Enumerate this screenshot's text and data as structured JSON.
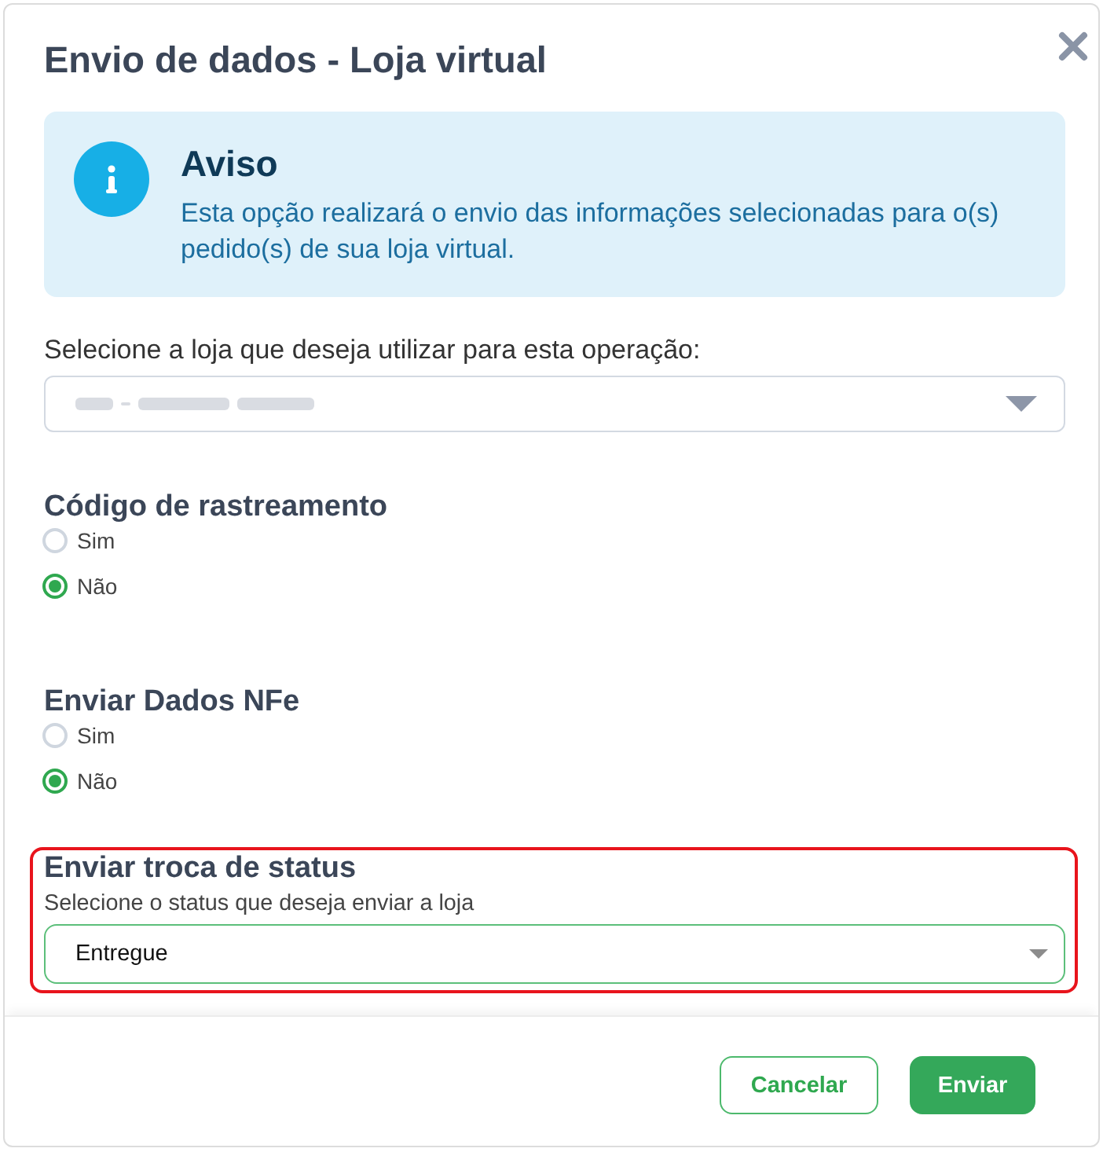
{
  "dialog": {
    "title": "Envio de dados - Loja virtual"
  },
  "notice": {
    "title": "Aviso",
    "text": "Esta opção realizará o envio das informações selecionadas para o(s) pedido(s) de sua loja virtual."
  },
  "store_select": {
    "label": "Selecione a loja que deseja utilizar para esta operação:",
    "redacted_value": true
  },
  "option_groups": [
    {
      "title": "Código de rastreamento",
      "choices": [
        {
          "label": "Sim",
          "selected": false
        },
        {
          "label": "Não",
          "selected": true
        }
      ]
    },
    {
      "title": "Enviar Dados NFe",
      "choices": [
        {
          "label": "Sim",
          "selected": false
        },
        {
          "label": "Não",
          "selected": true
        }
      ]
    }
  ],
  "status_section": {
    "highlighted": true,
    "title": "Enviar troca de status",
    "hint": "Selecione o status que deseja enviar a loja",
    "value": "Entregue",
    "focused": true
  },
  "buttons": [
    {
      "label": "Cancelar",
      "kind": "secondary"
    },
    {
      "label": "Enviar",
      "kind": "primary"
    }
  ]
}
